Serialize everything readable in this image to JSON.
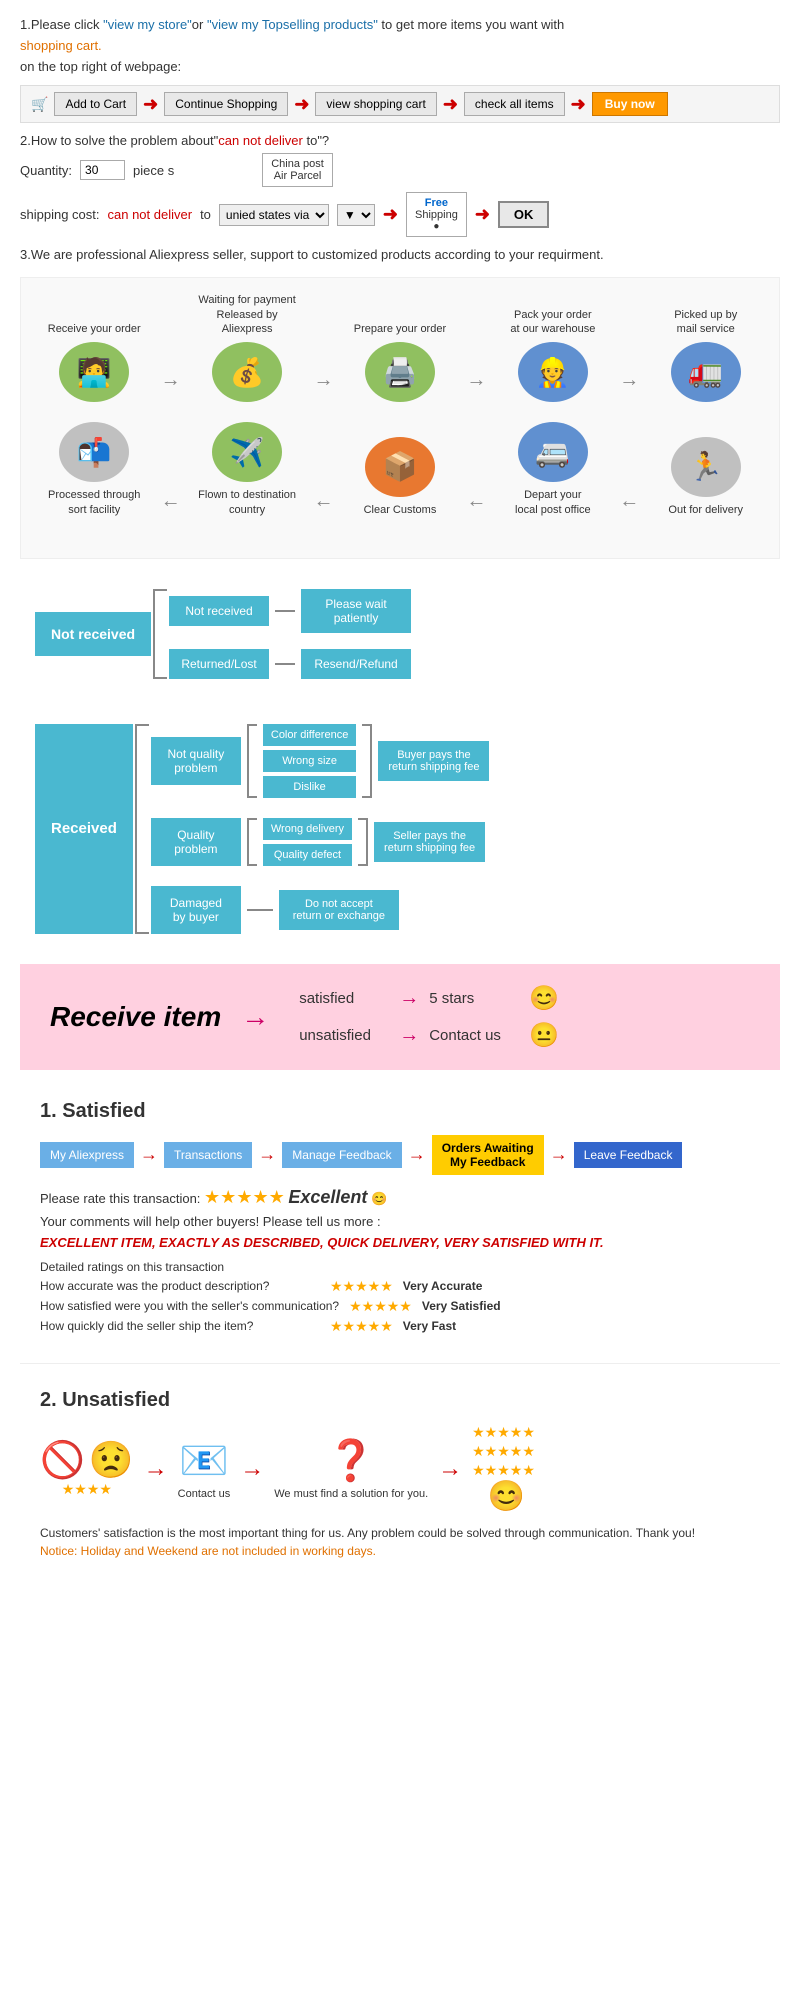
{
  "section1": {
    "text1": "1.Please click ",
    "link1": "\"view my store\"",
    "text2": "or ",
    "link2": "\"view my Topselling products\"",
    "text3": " to get more items you want with",
    "text4": "shopping cart.",
    "text5": "on the top right of webpage:",
    "btn_add": "Add to Cart",
    "btn_continue": "Continue Shopping",
    "btn_view": "view shopping cart",
    "btn_check": "check all items",
    "btn_buy": "Buy now"
  },
  "section2": {
    "title": "2.How to solve the problem about\"can not deliver to\"?",
    "qty_label": "Quantity:",
    "qty_value": "30",
    "qty_unit": "piece s",
    "shipping_label": "shipping cost:",
    "cannot_deliver": "can not deliver",
    "to_text": " to ",
    "via_text": "unied states via",
    "china_post_line1": "China post",
    "china_post_line2": "Air Parcel",
    "free_text": "Free",
    "shipping_text": "Shipping",
    "ok_btn": "OK"
  },
  "section3": {
    "text": "3.We are professional Aliexpress seller, support to customized products according to your requirment."
  },
  "flow": {
    "steps_row1": [
      {
        "label": "Receive your order",
        "icon": "🧑‍💻"
      },
      {
        "label": "Waiting for payment\nReleased by Aliexpress",
        "icon": "💰"
      },
      {
        "label": "Prepare your order",
        "icon": "🖨️"
      },
      {
        "label": "Pack your order\nat our warehouse",
        "icon": "👷"
      },
      {
        "label": "Picked up by\nmail service",
        "icon": "🚛"
      }
    ],
    "steps_row2": [
      {
        "label": "Out for delivery",
        "icon": "🏃"
      },
      {
        "label": "Depart your\nlocal post office",
        "icon": "🚐"
      },
      {
        "label": "Clear Customs",
        "icon": "📦"
      },
      {
        "label": "Flown to destination\ncountry",
        "icon": "✈️"
      },
      {
        "label": "Processed through\nsort facility",
        "icon": "📬"
      }
    ]
  },
  "not_received_tree": {
    "root": "Not received",
    "branch1": "Not received",
    "result1": "Please wait\npatiently",
    "branch2": "Returned/Lost",
    "result2": "Resend/Refund"
  },
  "received_tree": {
    "root": "Received",
    "branch1": {
      "label": "Not quality\nproblem",
      "sub": [
        "Color difference",
        "Wrong size",
        "Dislike"
      ],
      "final": "Buyer pays the\nreturn shipping fee"
    },
    "branch2": {
      "label": "Quality\nproblem",
      "sub": [
        "Wrong delivery",
        "Quality defect"
      ],
      "final": "Seller pays the\nreturn shipping fee"
    },
    "branch3": {
      "label": "Damaged\nby buyer",
      "result": "Do not accept\nreturn or exchange"
    }
  },
  "receive_item": {
    "title": "Receive item",
    "satisfied": "satisfied",
    "unsatisfied": "unsatisfied",
    "result1": "5 stars",
    "result2": "Contact us",
    "emoji1": "😊",
    "emoji2": "😐"
  },
  "satisfied": {
    "title": "1. Satisfied",
    "step1": "My Aliexpress",
    "step2": "Transactions",
    "step3": "Manage Feedback",
    "step4": "Orders Awaiting\nMy Feedback",
    "step5": "Leave Feedback",
    "rate_text": "Please rate this transaction:",
    "stars": "★★★★★",
    "excellent": "Excellent",
    "emoji": "😊",
    "comment1": "Your comments will help other buyers! Please tell us more :",
    "example_review": "EXCELLENT ITEM, EXACTLY AS DESCRIBED, QUICK DELIVERY, VERY SATISFIED WITH IT.",
    "detailed_title": "Detailed ratings on this transaction",
    "rating1_label": "How accurate was the product description?",
    "rating2_label": "How satisfied were you with the seller's communication?",
    "rating3_label": "How quickly did the seller ship the item?",
    "rating1_result": "Very Accurate",
    "rating2_result": "Very Satisfied",
    "rating3_result": "Very Fast",
    "stars5": "★★★★★"
  },
  "unsatisfied": {
    "title": "2. Unsatisfied",
    "contact_label": "Contact us",
    "find_solution": "We must find\na solution for\nyou.",
    "notice": "Customers' satisfaction is the most important thing for us. Any problem could be solved through\ncommunication. Thank you!",
    "notice_holiday": "Notice: Holiday and Weekend are not included in working days."
  }
}
